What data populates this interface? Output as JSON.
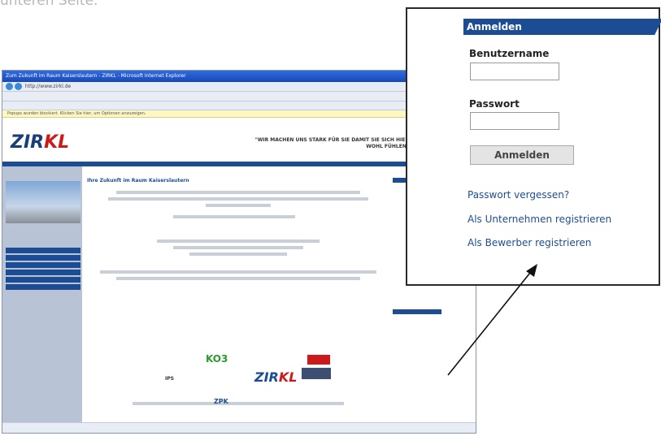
{
  "intro_fragment": "unteren Seite.",
  "browser": {
    "title": "Zum Zukunft im Raum Kaiserslautern - ZIRKL - Microsoft Internet Explorer",
    "toolbar_address": "http://www.zirkl.de",
    "info_bar": "Popups wurden blockiert. Klicken Sie hier, um Optionen anzuzeigen.",
    "logo_part1": "ZIR",
    "logo_part2": "KL",
    "slogan": "\"WIR MACHEN UNS STARK FÜR SIE DAMIT SIE SICH HIER WOHL FÜHLEN\"",
    "content_title": "Ihre Zukunft im Raum Kaiserslautern"
  },
  "login": {
    "header": "Anmelden",
    "username_label": "Benutzername",
    "password_label": "Passwort",
    "submit_label": "Anmelden",
    "forgot_link": "Passwort vergessen?",
    "register_company_link": "Als Unternehmen registrieren",
    "register_applicant_link": "Als Bewerber registrieren"
  },
  "colors": {
    "brand_blue": "#1c4d94",
    "brand_red": "#cc1a1a"
  }
}
